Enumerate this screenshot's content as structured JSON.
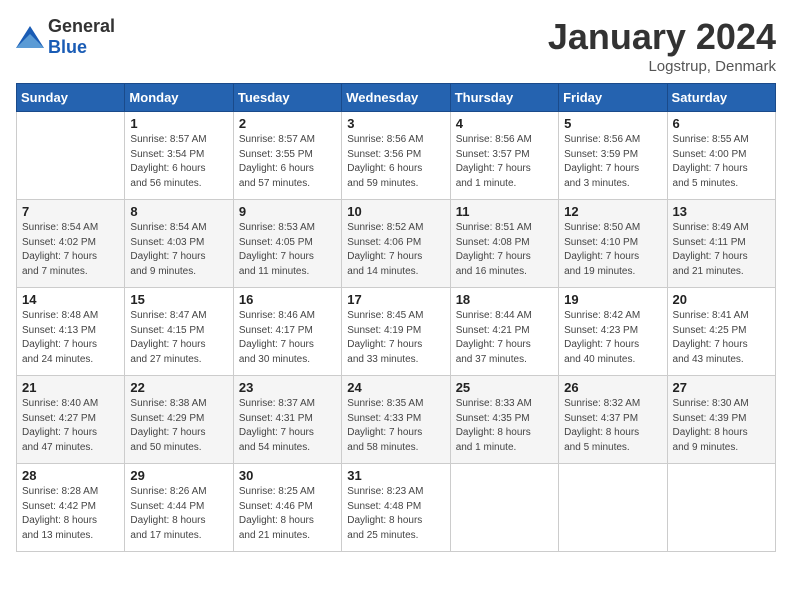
{
  "header": {
    "logo_general": "General",
    "logo_blue": "Blue",
    "month_title": "January 2024",
    "subtitle": "Logstrup, Denmark"
  },
  "days_of_week": [
    "Sunday",
    "Monday",
    "Tuesday",
    "Wednesday",
    "Thursday",
    "Friday",
    "Saturday"
  ],
  "weeks": [
    [
      {
        "day": "",
        "info": ""
      },
      {
        "day": "1",
        "info": "Sunrise: 8:57 AM\nSunset: 3:54 PM\nDaylight: 6 hours\nand 56 minutes."
      },
      {
        "day": "2",
        "info": "Sunrise: 8:57 AM\nSunset: 3:55 PM\nDaylight: 6 hours\nand 57 minutes."
      },
      {
        "day": "3",
        "info": "Sunrise: 8:56 AM\nSunset: 3:56 PM\nDaylight: 6 hours\nand 59 minutes."
      },
      {
        "day": "4",
        "info": "Sunrise: 8:56 AM\nSunset: 3:57 PM\nDaylight: 7 hours\nand 1 minute."
      },
      {
        "day": "5",
        "info": "Sunrise: 8:56 AM\nSunset: 3:59 PM\nDaylight: 7 hours\nand 3 minutes."
      },
      {
        "day": "6",
        "info": "Sunrise: 8:55 AM\nSunset: 4:00 PM\nDaylight: 7 hours\nand 5 minutes."
      }
    ],
    [
      {
        "day": "7",
        "info": "Sunrise: 8:54 AM\nSunset: 4:02 PM\nDaylight: 7 hours\nand 7 minutes."
      },
      {
        "day": "8",
        "info": "Sunrise: 8:54 AM\nSunset: 4:03 PM\nDaylight: 7 hours\nand 9 minutes."
      },
      {
        "day": "9",
        "info": "Sunrise: 8:53 AM\nSunset: 4:05 PM\nDaylight: 7 hours\nand 11 minutes."
      },
      {
        "day": "10",
        "info": "Sunrise: 8:52 AM\nSunset: 4:06 PM\nDaylight: 7 hours\nand 14 minutes."
      },
      {
        "day": "11",
        "info": "Sunrise: 8:51 AM\nSunset: 4:08 PM\nDaylight: 7 hours\nand 16 minutes."
      },
      {
        "day": "12",
        "info": "Sunrise: 8:50 AM\nSunset: 4:10 PM\nDaylight: 7 hours\nand 19 minutes."
      },
      {
        "day": "13",
        "info": "Sunrise: 8:49 AM\nSunset: 4:11 PM\nDaylight: 7 hours\nand 21 minutes."
      }
    ],
    [
      {
        "day": "14",
        "info": "Sunrise: 8:48 AM\nSunset: 4:13 PM\nDaylight: 7 hours\nand 24 minutes."
      },
      {
        "day": "15",
        "info": "Sunrise: 8:47 AM\nSunset: 4:15 PM\nDaylight: 7 hours\nand 27 minutes."
      },
      {
        "day": "16",
        "info": "Sunrise: 8:46 AM\nSunset: 4:17 PM\nDaylight: 7 hours\nand 30 minutes."
      },
      {
        "day": "17",
        "info": "Sunrise: 8:45 AM\nSunset: 4:19 PM\nDaylight: 7 hours\nand 33 minutes."
      },
      {
        "day": "18",
        "info": "Sunrise: 8:44 AM\nSunset: 4:21 PM\nDaylight: 7 hours\nand 37 minutes."
      },
      {
        "day": "19",
        "info": "Sunrise: 8:42 AM\nSunset: 4:23 PM\nDaylight: 7 hours\nand 40 minutes."
      },
      {
        "day": "20",
        "info": "Sunrise: 8:41 AM\nSunset: 4:25 PM\nDaylight: 7 hours\nand 43 minutes."
      }
    ],
    [
      {
        "day": "21",
        "info": "Sunrise: 8:40 AM\nSunset: 4:27 PM\nDaylight: 7 hours\nand 47 minutes."
      },
      {
        "day": "22",
        "info": "Sunrise: 8:38 AM\nSunset: 4:29 PM\nDaylight: 7 hours\nand 50 minutes."
      },
      {
        "day": "23",
        "info": "Sunrise: 8:37 AM\nSunset: 4:31 PM\nDaylight: 7 hours\nand 54 minutes."
      },
      {
        "day": "24",
        "info": "Sunrise: 8:35 AM\nSunset: 4:33 PM\nDaylight: 7 hours\nand 58 minutes."
      },
      {
        "day": "25",
        "info": "Sunrise: 8:33 AM\nSunset: 4:35 PM\nDaylight: 8 hours\nand 1 minute."
      },
      {
        "day": "26",
        "info": "Sunrise: 8:32 AM\nSunset: 4:37 PM\nDaylight: 8 hours\nand 5 minutes."
      },
      {
        "day": "27",
        "info": "Sunrise: 8:30 AM\nSunset: 4:39 PM\nDaylight: 8 hours\nand 9 minutes."
      }
    ],
    [
      {
        "day": "28",
        "info": "Sunrise: 8:28 AM\nSunset: 4:42 PM\nDaylight: 8 hours\nand 13 minutes."
      },
      {
        "day": "29",
        "info": "Sunrise: 8:26 AM\nSunset: 4:44 PM\nDaylight: 8 hours\nand 17 minutes."
      },
      {
        "day": "30",
        "info": "Sunrise: 8:25 AM\nSunset: 4:46 PM\nDaylight: 8 hours\nand 21 minutes."
      },
      {
        "day": "31",
        "info": "Sunrise: 8:23 AM\nSunset: 4:48 PM\nDaylight: 8 hours\nand 25 minutes."
      },
      {
        "day": "",
        "info": ""
      },
      {
        "day": "",
        "info": ""
      },
      {
        "day": "",
        "info": ""
      }
    ]
  ]
}
